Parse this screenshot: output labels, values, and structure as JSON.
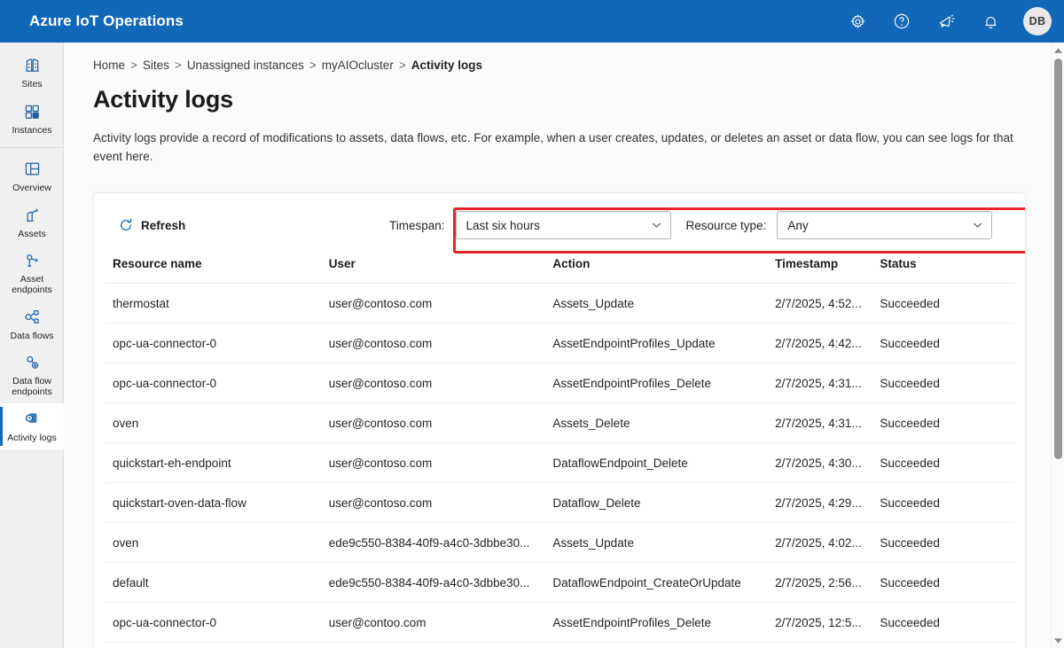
{
  "topbar": {
    "brand": "Azure IoT Operations",
    "icons": [
      {
        "name": "settings-icon",
        "label": "Settings"
      },
      {
        "name": "help-icon",
        "label": "Help"
      },
      {
        "name": "feedback-icon",
        "label": "Feedback"
      },
      {
        "name": "notifications-icon",
        "label": "Notifications"
      }
    ],
    "avatar_initials": "DB"
  },
  "sidebar": {
    "items": [
      {
        "label": "Sites",
        "icon": "sites-icon",
        "active": false
      },
      {
        "label": "Instances",
        "icon": "instances-icon",
        "active": false
      },
      {
        "label": "Overview",
        "icon": "overview-icon",
        "active": false
      },
      {
        "label": "Assets",
        "icon": "assets-icon",
        "active": false
      },
      {
        "label": "Asset endpoints",
        "icon": "asset-endpoints-icon",
        "active": false
      },
      {
        "label": "Data flows",
        "icon": "data-flows-icon",
        "active": false
      },
      {
        "label": "Data flow endpoints",
        "icon": "data-flow-endpoints-icon",
        "active": false
      },
      {
        "label": "Activity logs",
        "icon": "activity-logs-icon",
        "active": true
      }
    ]
  },
  "breadcrumb": {
    "items": [
      "Home",
      "Sites",
      "Unassigned instances",
      "myAIOcluster",
      "Activity logs"
    ],
    "separator": ">"
  },
  "page": {
    "title": "Activity logs",
    "description": "Activity logs provide a record of modifications to assets, data flows, etc. For example, when a user creates, updates, or deletes an asset or data flow, you can see logs for that event here."
  },
  "toolbar": {
    "refresh_label": "Refresh",
    "refresh_icon": "refresh-icon",
    "timespan_label": "Timespan:",
    "timespan_value": "Last six hours",
    "resource_type_label": "Resource type:",
    "resource_type_value": "Any",
    "highlight_color": "#e8232a"
  },
  "table": {
    "columns": [
      "Resource name",
      "User",
      "Action",
      "Timestamp",
      "Status"
    ],
    "rows": [
      {
        "resource": "thermostat",
        "user": "user@contoso.com",
        "action": "Assets_Update",
        "timestamp": "2/7/2025, 4:52...",
        "status": "Succeeded"
      },
      {
        "resource": "opc-ua-connector-0",
        "user": "user@contoso.com",
        "action": "AssetEndpointProfiles_Update",
        "timestamp": "2/7/2025, 4:42...",
        "status": "Succeeded"
      },
      {
        "resource": "opc-ua-connector-0",
        "user": "user@contoso.com",
        "action": "AssetEndpointProfiles_Delete",
        "timestamp": "2/7/2025, 4:31...",
        "status": "Succeeded"
      },
      {
        "resource": "oven",
        "user": "user@contoso.com",
        "action": "Assets_Delete",
        "timestamp": "2/7/2025, 4:31...",
        "status": "Succeeded"
      },
      {
        "resource": "quickstart-eh-endpoint",
        "user": "user@contoso.com",
        "action": "DataflowEndpoint_Delete",
        "timestamp": "2/7/2025, 4:30...",
        "status": "Succeeded"
      },
      {
        "resource": "quickstart-oven-data-flow",
        "user": "user@contoso.com",
        "action": "Dataflow_Delete",
        "timestamp": "2/7/2025, 4:29...",
        "status": "Succeeded"
      },
      {
        "resource": "oven",
        "user": "ede9c550-8384-40f9-a4c0-3dbbe30...",
        "action": "Assets_Update",
        "timestamp": "2/7/2025, 4:02...",
        "status": "Succeeded"
      },
      {
        "resource": "default",
        "user": "ede9c550-8384-40f9-a4c0-3dbbe30...",
        "action": "DataflowEndpoint_CreateOrUpdate",
        "timestamp": "2/7/2025, 2:56...",
        "status": "Succeeded"
      },
      {
        "resource": "opc-ua-connector-0",
        "user": "user@contoo.com",
        "action": "AssetEndpointProfiles_Delete",
        "timestamp": "2/7/2025, 12:5...",
        "status": "Succeeded"
      }
    ]
  },
  "theme": {
    "brand_blue": "#1267b8",
    "icon_blue": "#1f60a8",
    "highlight_red": "#e8232a"
  }
}
